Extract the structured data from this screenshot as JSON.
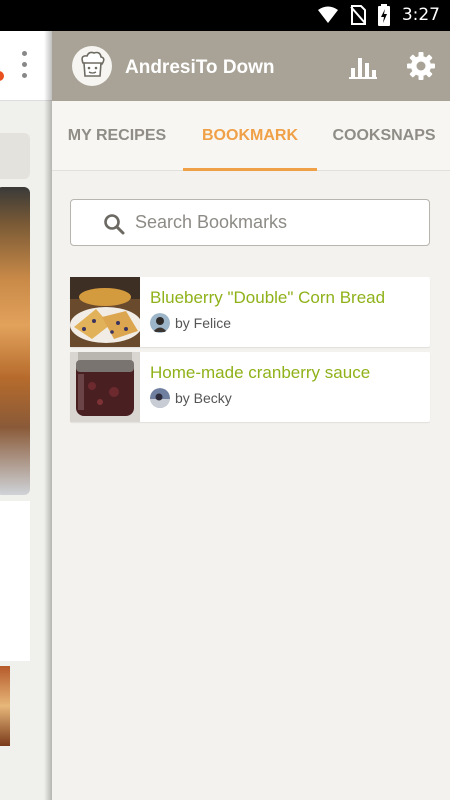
{
  "status_bar": {
    "time": "3:27"
  },
  "header": {
    "username": "AndresiTo Down"
  },
  "tabs": [
    {
      "label": "MY RECIPES",
      "active": false
    },
    {
      "label": "BOOKMARK",
      "active": true
    },
    {
      "label": "COOKSNAPS",
      "active": false
    }
  ],
  "search": {
    "placeholder": "Search Bookmarks",
    "value": ""
  },
  "bookmarks": [
    {
      "title": "Blueberry \"Double\" Corn Bread",
      "author": "by Felice"
    },
    {
      "title": "Home-made cranberry sauce",
      "author": "by Becky"
    }
  ],
  "colors": {
    "header_bg": "#a8a396",
    "accent": "#f0a148",
    "title_green": "#8fb21a"
  },
  "icons": [
    "wifi-icon",
    "no-sim-icon",
    "battery-charging-icon",
    "chef-avatar-icon",
    "stats-icon",
    "settings-icon",
    "search-icon"
  ]
}
